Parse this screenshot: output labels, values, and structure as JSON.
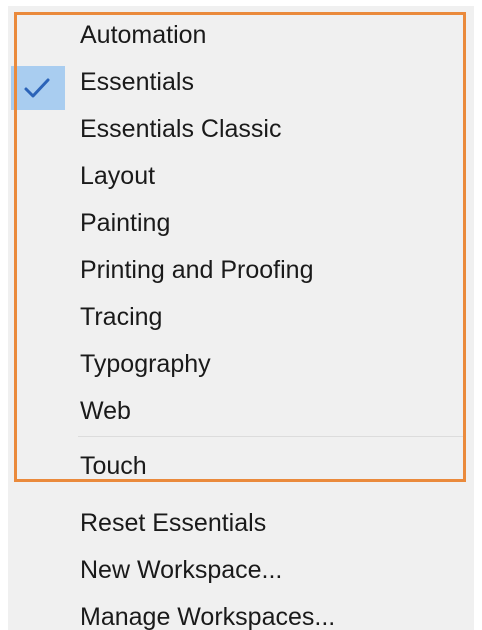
{
  "menu": {
    "selected": "Essentials",
    "items": [
      {
        "label": "Automation"
      },
      {
        "label": "Essentials"
      },
      {
        "label": "Essentials Classic"
      },
      {
        "label": "Layout"
      },
      {
        "label": "Painting"
      },
      {
        "label": "Printing and Proofing"
      },
      {
        "label": "Tracing"
      },
      {
        "label": "Typography"
      },
      {
        "label": "Web"
      },
      {
        "label": "Touch"
      }
    ],
    "actions": [
      {
        "label": "Reset Essentials"
      },
      {
        "label": "New Workspace..."
      },
      {
        "label": "Manage Workspaces..."
      }
    ]
  },
  "icons": {
    "check": "check-icon"
  },
  "colors": {
    "menu_background": "#f0f0f0",
    "selection_background": "#a9cdf0",
    "check_mark": "#2b63b8",
    "highlight_frame": "#ea8a3c",
    "text": "#1a1a1a"
  }
}
